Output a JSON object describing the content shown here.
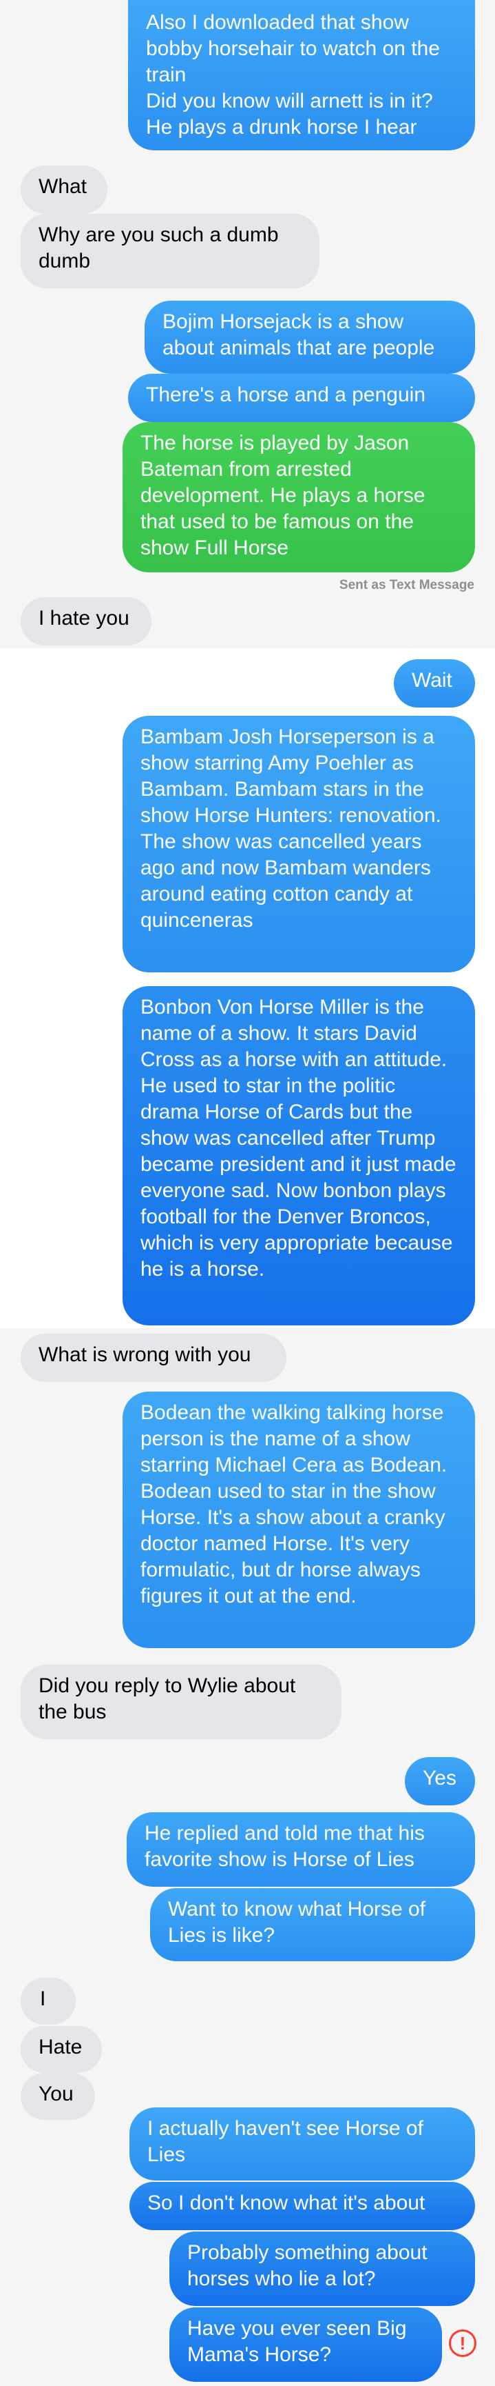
{
  "screens": [
    {
      "messages": [
        {
          "dir": "out",
          "text": "Also I downloaded that show bobby horsehair to watch on the train\nDid you know will arnett is in it? He plays a drunk horse I hear"
        },
        {
          "dir": "in",
          "text": "What"
        },
        {
          "dir": "in",
          "text": "Why are you such a dumb dumb"
        },
        {
          "dir": "out",
          "text": "Bojim Horsejack is a show about animals that are people"
        },
        {
          "dir": "out",
          "text": "There's a horse and a penguin"
        },
        {
          "dir": "sms",
          "text": "The horse is played by Jason Bateman from arrested development. He plays a horse that used to be famous on the show Full Horse"
        },
        {
          "dir": "in",
          "text": "I hate you"
        }
      ],
      "status": "Sent as Text Message"
    },
    {
      "messages": [
        {
          "dir": "out",
          "text": "Wait"
        },
        {
          "dir": "out",
          "text": "Bambam Josh Horseperson is a show starring Amy Poehler as Bambam. Bambam stars in the show Horse Hunters: renovation. The show was cancelled years ago and now Bambam wanders around eating cotton candy at quinceneras"
        },
        {
          "dir": "out",
          "text": "Bonbon Von Horse Miller is the name of a show. It stars David Cross as a horse with an attitude. He used to star in the politic drama Horse of Cards but the show was cancelled after Trump became president and it just made everyone sad. Now bonbon plays football for the Denver Broncos, which is very appropriate because he is a horse."
        }
      ]
    },
    {
      "messages": [
        {
          "dir": "in",
          "text": "What is wrong with you"
        },
        {
          "dir": "out",
          "text": "Bodean the walking talking horse person is the name of a show starring Michael Cera as Bodean. Bodean used to star in the show Horse. It's a show about a cranky doctor named Horse. It's very formulatic, but dr horse always figures it out at the end."
        },
        {
          "dir": "in",
          "text": "Did you reply to Wylie about the bus"
        }
      ]
    },
    {
      "messages": [
        {
          "dir": "out",
          "text": "Yes"
        },
        {
          "dir": "out",
          "text": "He replied and told me that his favorite show is Horse of Lies"
        },
        {
          "dir": "out",
          "text": "Want to know what Horse of Lies is like?"
        },
        {
          "dir": "in",
          "text": "I"
        },
        {
          "dir": "in",
          "text": "Hate"
        },
        {
          "dir": "in",
          "text": "You"
        },
        {
          "dir": "out",
          "text": "I actually haven't see Horse of Lies"
        },
        {
          "dir": "out",
          "text": "So I don't know what it's about"
        },
        {
          "dir": "out",
          "text": "Probably something about horses who lie a lot?"
        },
        {
          "dir": "out",
          "text": "Have you ever seen Big Mama's Horse?"
        }
      ],
      "error_icon": "!"
    }
  ]
}
